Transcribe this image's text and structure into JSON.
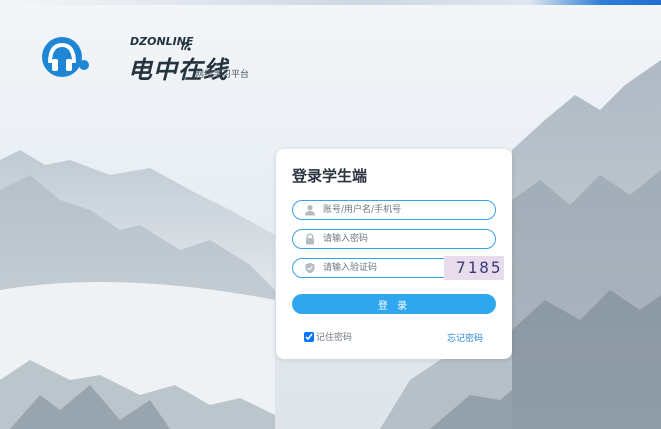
{
  "brand": {
    "name": "电中在线",
    "english": "DZONLINE",
    "subtitle": "网络学习平台"
  },
  "login": {
    "title": "登录学生端",
    "username_placeholder": "账号/用户名/手机号",
    "password_placeholder": "请输入密码",
    "captcha_placeholder": "请输入验证码",
    "captcha_code": "7185",
    "submit_label": "登 录",
    "remember_label": "记住密码",
    "remember_checked": true,
    "forgot_label": "忘记密码"
  },
  "icons": {
    "username": "user-icon",
    "password": "lock-icon",
    "captcha": "shield-icon"
  },
  "colors": {
    "accent": "#2ea7ee",
    "field_border": "#3aa1e6",
    "link": "#2a8ad6",
    "brand_blue": "#1f86d6"
  }
}
